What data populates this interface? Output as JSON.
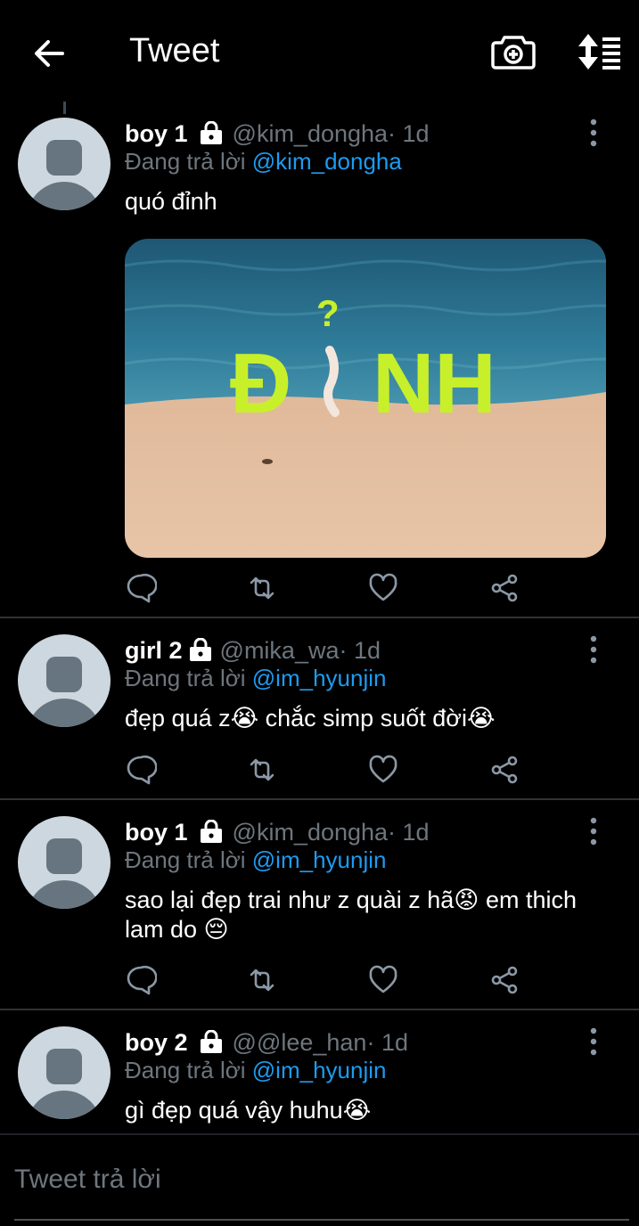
{
  "header": {
    "title": "Tweet",
    "back_icon": "arrow-left-icon",
    "camera_icon": "camera-plus-icon",
    "sort_icon": "sort-list-icon"
  },
  "colors": {
    "background": "#000000",
    "accent": "#1d9bf0",
    "secondary_text": "#6e767d",
    "divider": "#2f3336",
    "avatar_bg": "#cdd7df",
    "avatar_fg": "#66757f"
  },
  "replying_prefix": "Đang trả lời ",
  "tweets": [
    {
      "name": "boy 1",
      "handle": "@kim_dongha",
      "time": " · 1d",
      "replying_to": "@kim_dongha",
      "text": "quó đỉnh",
      "media": {
        "caption_letters": "Đ",
        "caption_end": "NH",
        "question_mark": "?"
      }
    },
    {
      "name": "girl 2",
      "handle": "@mika_wa",
      "time": " · 1d",
      "replying_to": "@im_hyunjin",
      "text": "đẹp quá z😭 chắc simp suốt đời😭"
    },
    {
      "name": "boy 1",
      "handle": "@kim_dongha",
      "time": " · 1d",
      "replying_to": "@im_hyunjin",
      "text": "sao lại đẹp trai như z quài z hã😡 em thich lam do 😔"
    },
    {
      "name": "boy 2",
      "handle": "@@lee_han",
      "time": " · 1d",
      "replying_to": "@im_hyunjin",
      "text": "gì đẹp quá vậy huhu😭"
    }
  ],
  "reply": {
    "placeholder": "Tweet trả lời"
  }
}
